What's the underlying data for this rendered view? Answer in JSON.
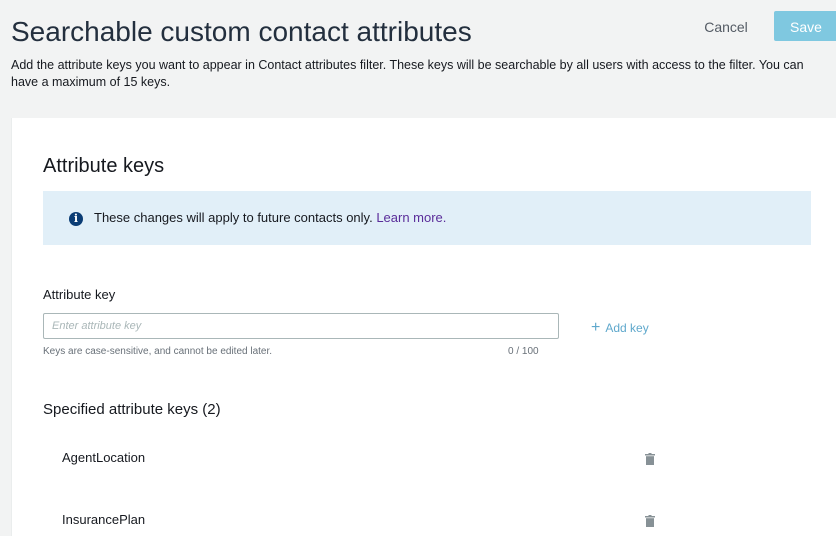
{
  "header": {
    "title": "Searchable custom contact attributes",
    "description": "Add the attribute keys you want to appear in Contact attributes filter. These keys will be searchable by all users with access to the filter. You can have a maximum of 15 keys.",
    "cancel_label": "Cancel",
    "save_label": "Save"
  },
  "attribute_keys": {
    "section_title": "Attribute keys",
    "info": {
      "icon": "info-icon",
      "text": "These changes will apply to future contacts only.",
      "link_text": "Learn more."
    },
    "field": {
      "label": "Attribute key",
      "value": "",
      "placeholder": "Enter attribute key",
      "help": "Keys are case-sensitive, and cannot be edited later.",
      "counter": "0 / 100"
    },
    "add_key_label": "Add key",
    "list_title": "Specified attribute keys (2)",
    "keys": [
      {
        "name": "AgentLocation",
        "delete_icon": "trash-icon"
      },
      {
        "name": "InsurancePlan",
        "delete_icon": "trash-icon"
      }
    ]
  },
  "colors": {
    "save_button": "#7fc8e0",
    "info_background": "#e1eff8",
    "info_icon": "#0b3d75",
    "link": "#5a2d9a",
    "add_key": "#5fa8cc"
  }
}
